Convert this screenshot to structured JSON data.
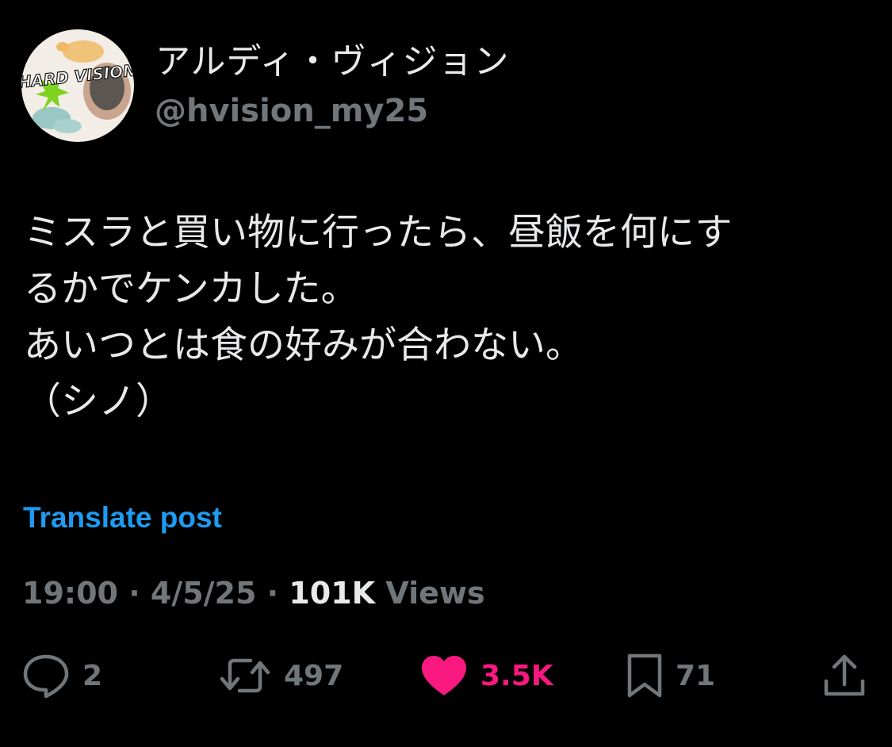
{
  "author": {
    "display_name": "アルディ・ヴィジョン",
    "handle": "@hvision_my25",
    "avatar_text": "HARD VISION"
  },
  "post": {
    "lines": [
      "ミスラと買い物に行ったら、昼飯を何にす",
      "るかでケンカした。",
      "あいつとは食の好みが合わない。",
      "（シノ）"
    ],
    "translate_label": "Translate post"
  },
  "meta": {
    "time": "19:00",
    "date": "4/5/25",
    "views_count": "101K",
    "views_label": "Views"
  },
  "actions": {
    "reply": {
      "icon": "reply-icon",
      "count": "2"
    },
    "repost": {
      "icon": "repost-icon",
      "count": "497"
    },
    "like": {
      "icon": "heart-icon",
      "count": "3.5K",
      "liked": true
    },
    "bookmark": {
      "icon": "bookmark-icon",
      "count": "71"
    },
    "share": {
      "icon": "share-icon"
    }
  },
  "colors": {
    "background": "#000000",
    "text_primary": "#e7e9ea",
    "text_secondary": "#71767b",
    "link": "#1d9bf0",
    "like": "#f91880"
  }
}
